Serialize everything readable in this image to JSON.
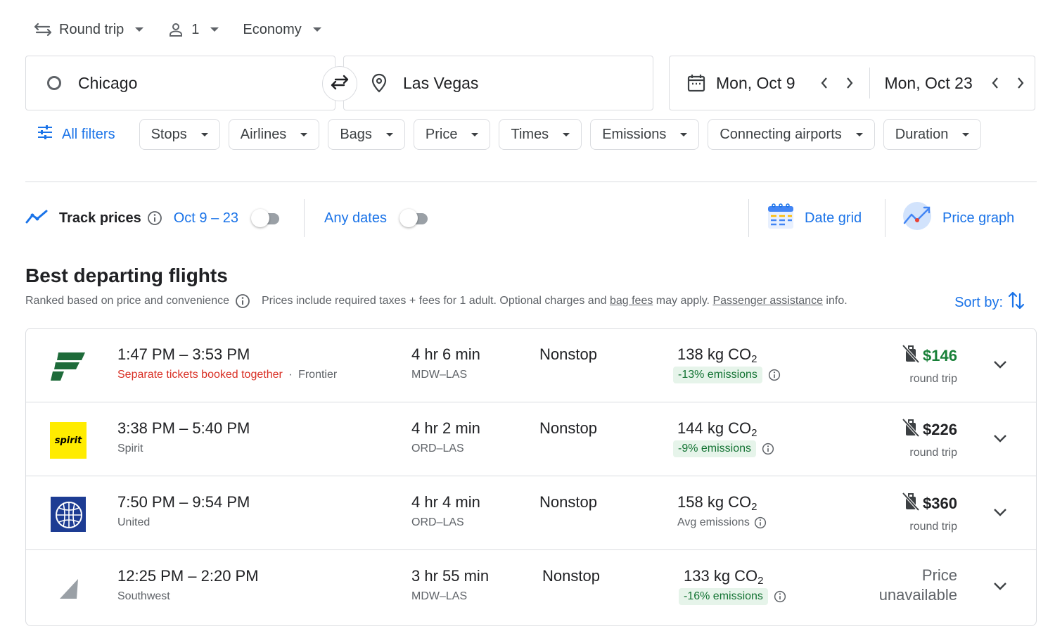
{
  "trip_options": {
    "trip_type": "Round trip",
    "passengers": "1",
    "cabin": "Economy"
  },
  "search": {
    "origin": "Chicago",
    "destination": "Las Vegas",
    "depart_date": "Mon, Oct 9",
    "return_date": "Mon, Oct 23"
  },
  "filters": {
    "all_filters": "All filters",
    "chips": [
      "Stops",
      "Airlines",
      "Bags",
      "Price",
      "Times",
      "Emissions",
      "Connecting airports",
      "Duration"
    ]
  },
  "tracking": {
    "track_prices": "Track prices",
    "date_range": "Oct 9 – 23",
    "any_dates": "Any dates",
    "date_grid": "Date grid",
    "price_graph": "Price graph"
  },
  "results": {
    "title": "Best departing flights",
    "ranked_note": "Ranked based on price and convenience",
    "prices_note_1": "Prices include required taxes + fees for 1 adult. Optional charges and",
    "bag_fees": "bag fees",
    "prices_note_2": "may apply.",
    "passenger_assistance": "Passenger assistance",
    "prices_note_3": "info.",
    "sort_by": "Sort by:",
    "flights": [
      {
        "times": "1:47 PM – 3:53 PM",
        "warning": "Separate tickets booked together",
        "separator": "·",
        "airline": "Frontier",
        "duration": "4 hr 6 min",
        "route": "MDW–LAS",
        "stops": "Nonstop",
        "co2_value": "138 kg CO",
        "co2_sub": "2",
        "emissions": "-13% emissions",
        "price": "$146",
        "price_sub": "round trip"
      },
      {
        "times": "3:38 PM – 5:40 PM",
        "warning": "",
        "separator": "",
        "airline": "Spirit",
        "duration": "4 hr 2 min",
        "route": "ORD–LAS",
        "stops": "Nonstop",
        "co2_value": "144 kg CO",
        "co2_sub": "2",
        "emissions": "-9% emissions",
        "price": "$226",
        "price_sub": "round trip",
        "logo_text": "spirit"
      },
      {
        "times": "7:50 PM – 9:54 PM",
        "warning": "",
        "separator": "",
        "airline": "United",
        "duration": "4 hr 4 min",
        "route": "ORD–LAS",
        "stops": "Nonstop",
        "co2_value": "158 kg CO",
        "co2_sub": "2",
        "emissions": "Avg emissions",
        "price": "$360",
        "price_sub": "round trip"
      },
      {
        "times": "12:25 PM – 2:20 PM",
        "warning": "",
        "separator": "",
        "airline": "Southwest",
        "duration": "3 hr 55 min",
        "route": "MDW–LAS",
        "stops": "Nonstop",
        "co2_value": "133 kg CO",
        "co2_sub": "2",
        "emissions": "-16% emissions",
        "price_na_1": "Price",
        "price_na_2": "unavailable"
      }
    ]
  },
  "colors": {
    "accent_blue": "#1a73e8",
    "price_green": "#188038",
    "warning_red": "#d93025",
    "emissions_badge_bg": "#e6f4ea",
    "frontier_green": "#1e6b3a",
    "spirit_yellow": "#ffec00",
    "united_blue": "#1d3c93"
  },
  "icons": {
    "trip_type": "swap-horiz-icon",
    "passengers": "person-icon",
    "swap": "swap-arrows-icon",
    "destination": "location-pin-icon",
    "calendar": "calendar-icon",
    "filters": "tune-icon",
    "track": "trending-line-icon",
    "info": "info-icon",
    "date_grid": "date-grid-icon",
    "price_graph": "price-graph-icon",
    "sort": "sort-arrows-icon",
    "no_bag": "no-carry-on-icon",
    "expand": "chevron-down-icon"
  }
}
